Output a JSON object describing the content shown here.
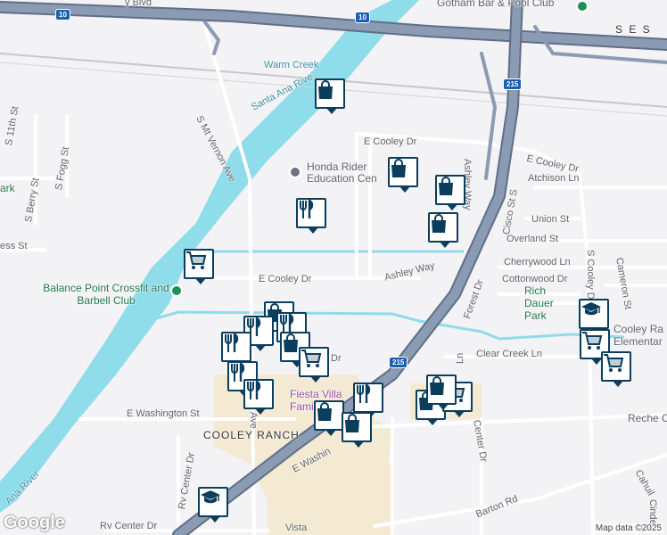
{
  "colors": {
    "background": "#f3f2f4",
    "water": "#8fdcea",
    "freeway": "#7f90a8",
    "freeway_casing": "#5f6f88",
    "road": "#ffffff",
    "road_casing": "#cfd3d8",
    "residential_area": "#f4ead3",
    "pin_border": "#0b3d5c",
    "poi_green": "#1e8e5a",
    "poi_grey": "#6b7280",
    "poi_purple": "#9b4fa3",
    "shield_blue": "#1a5fb4"
  },
  "labels": {
    "gotham": "Gotham Bar & Pool Club",
    "warm_creek": "Warm Creek",
    "santa_ana_top": "Santa Ana Rive",
    "santa_ana_bottom": "Ana River",
    "mt_vernon": "S Mt Vernon Ave",
    "honda": "Honda Rider Education Cen",
    "e_cooley_top": "E Cooley Dr",
    "e_cooley_right": "E Cooley Dr",
    "e_cooley_mid": "E Cooley Dr",
    "ashley_way": "Ashley Way",
    "ashley_way_vert": "Ashley Way",
    "atchison": "Atchison Ln",
    "cisco": "Cisco St S",
    "union": "Union St",
    "overland": "Overland St",
    "cherrywood": "Cherrywood Ln",
    "cottonwood": "Cottonwood Dr",
    "forest": "Forest Dr",
    "cameron": "Cameron St",
    "s_cooley": "S Cooley Dr",
    "rich_dauer": "Rich Dauer Park",
    "cooley_ranch_elem": "Cooley Ra Elementar",
    "balance_point": "Balance Point Crossfit and Barbell Club",
    "clear_creek": "Clear Creek Ln",
    "fiesta": "Fiesta Villa Family",
    "cooley_ranch": "COOLEY RANCH",
    "e_washington": "E Washington St",
    "e_washington_2": "E Washin",
    "reche": "Reche Ca",
    "barton": "Barton Rd",
    "center_dr": "Center Dr",
    "rv_center": "Rv Center Dr",
    "rv_center_vert": "Rv Center Dr",
    "vista": "Vista",
    "cahuilla": "Cahuil",
    "s_11th": "S 11th St",
    "s_fogg": "S Fogg St",
    "s_berry": "S Berry St",
    "park": "ark",
    "ess_st": "ess St",
    "valley_blvd": "y Blvd",
    "ses": "S E S",
    "ave_frag": "Ave",
    "dr_frag": "Dr",
    "ln_frag": "Ln",
    "cinde": "Cinde"
  },
  "shields": {
    "i10_a": "10",
    "i10_b": "10",
    "i215_a": "215",
    "i215_b": "215"
  },
  "google": "Google",
  "attribution": "Map data ©2025",
  "pins": [
    {
      "type": "shopping",
      "icon": "shopping-bag-icon"
    },
    {
      "type": "shopping",
      "icon": "shopping-bag-icon"
    },
    {
      "type": "shopping",
      "icon": "shopping-bag-icon"
    },
    {
      "type": "shopping",
      "icon": "shopping-bag-icon"
    },
    {
      "type": "restaurant",
      "icon": "restaurant-icon"
    },
    {
      "type": "grocery",
      "icon": "shopping-cart-icon"
    },
    {
      "type": "shopping",
      "icon": "shopping-bag-icon"
    },
    {
      "type": "restaurant",
      "icon": "restaurant-icon"
    },
    {
      "type": "restaurant",
      "icon": "restaurant-icon"
    },
    {
      "type": "shopping",
      "icon": "shopping-bag-icon"
    },
    {
      "type": "restaurant",
      "icon": "restaurant-icon"
    },
    {
      "type": "grocery",
      "icon": "shopping-cart-icon"
    },
    {
      "type": "restaurant",
      "icon": "restaurant-icon"
    },
    {
      "type": "restaurant",
      "icon": "restaurant-icon"
    },
    {
      "type": "school",
      "icon": "school-icon"
    },
    {
      "type": "grocery",
      "icon": "shopping-cart-icon"
    },
    {
      "type": "grocery",
      "icon": "shopping-cart-icon"
    },
    {
      "type": "restaurant",
      "icon": "restaurant-icon"
    },
    {
      "type": "shopping",
      "icon": "shopping-bag-icon"
    },
    {
      "type": "shopping",
      "icon": "shopping-bag-icon"
    },
    {
      "type": "shopping",
      "icon": "shopping-bag-icon"
    },
    {
      "type": "grocery",
      "icon": "shopping-cart-icon"
    },
    {
      "type": "shopping",
      "icon": "shopping-bag-icon"
    },
    {
      "type": "school",
      "icon": "school-icon"
    }
  ]
}
